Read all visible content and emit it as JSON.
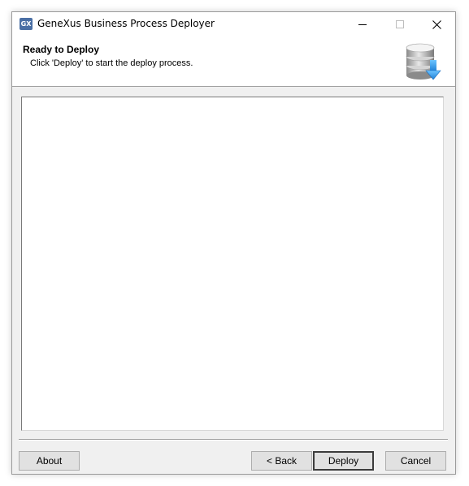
{
  "window": {
    "title": "GeneXus Business Process Deployer",
    "app_icon_text": "GX"
  },
  "header": {
    "title": "Ready to Deploy",
    "subtitle": "Click 'Deploy' to start the deploy process."
  },
  "log": {
    "content": ""
  },
  "buttons": {
    "about": "About",
    "back": "< Back",
    "deploy": "Deploy",
    "cancel": "Cancel"
  },
  "icons": {
    "app": "genexus-app-icon",
    "header": "database-download-icon",
    "minimize": "minimize-icon",
    "maximize": "maximize-icon",
    "close": "close-icon"
  },
  "colors": {
    "accent": "#1e90e6",
    "window_bg": "#f0f0f0",
    "button_bg": "#e1e1e1"
  }
}
